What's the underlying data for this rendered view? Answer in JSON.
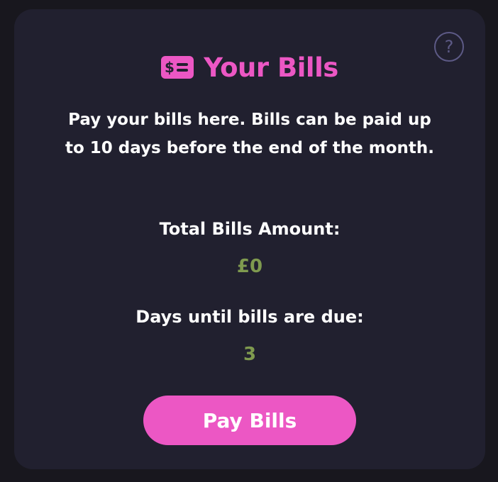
{
  "card": {
    "help_glyph": "?",
    "help_icon": "question-mark-icon",
    "title_icon": "bill-icon",
    "title": "Your Bills",
    "description": "Pay your bills here. Bills can be paid up to 10 days before the end of the month.",
    "total_label": "Total Bills Amount:",
    "total_value": "£0",
    "days_label": "Days until bills are due:",
    "days_value": "3",
    "pay_button": "Pay Bills"
  },
  "colors": {
    "background": "#18171e",
    "card": "#21202f",
    "accent": "#ec57c4",
    "value": "#7f9a4f",
    "help": "#5d5a86"
  }
}
